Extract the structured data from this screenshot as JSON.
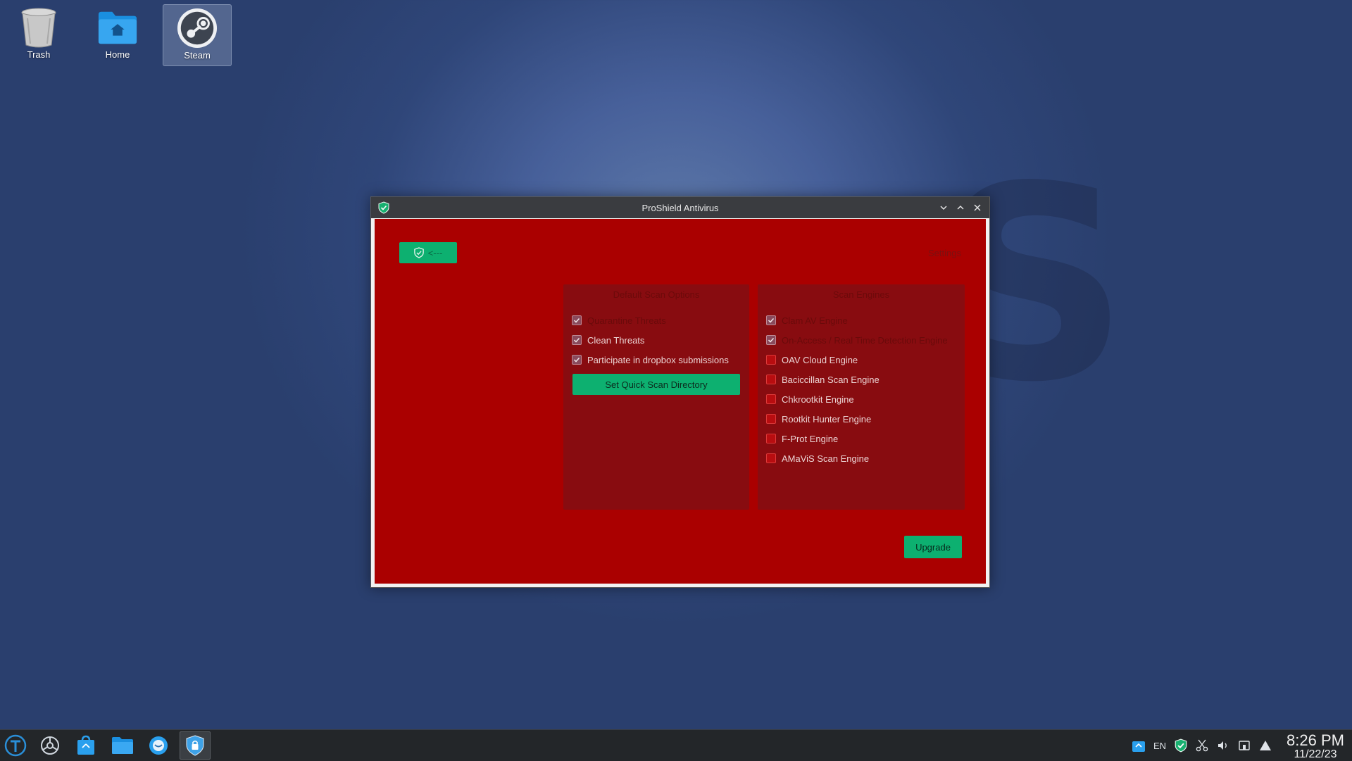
{
  "desktop": {
    "icons": [
      {
        "label": "Trash"
      },
      {
        "label": "Home"
      },
      {
        "label": "Steam"
      }
    ]
  },
  "window": {
    "title": "ProShield Antivirus",
    "back_button_label": "<---",
    "settings_label": "Settings",
    "default_scan_options": {
      "title": "Default Scan Options",
      "options": [
        {
          "label": "Quarantine Threats",
          "checked": true
        },
        {
          "label": "Clean Threats",
          "checked": true
        },
        {
          "label": "Participate in dropbox submissions",
          "checked": true
        }
      ],
      "set_dir_button": "Set Quick Scan Directory"
    },
    "scan_engines": {
      "title": "Scan Engines",
      "engines": [
        {
          "label": "Clam AV Engine",
          "checked": true
        },
        {
          "label": "On-Access / Real Time Detection Engine",
          "checked": true
        },
        {
          "label": "OAV Cloud Engine",
          "checked": false
        },
        {
          "label": "Baciccillan Scan Engine",
          "checked": false
        },
        {
          "label": "Chkrootkit Engine",
          "checked": false
        },
        {
          "label": "Rootkit Hunter Engine",
          "checked": false
        },
        {
          "label": "F-Prot Engine",
          "checked": false
        },
        {
          "label": "AMaViS Scan Engine",
          "checked": false
        }
      ]
    },
    "upgrade_button": "Upgrade"
  },
  "taskbar": {
    "tray": {
      "language": "EN"
    },
    "clock": {
      "time": "8:26 PM",
      "date": "11/22/23"
    }
  },
  "colors": {
    "content_bg": "#aa0000",
    "panel_bg": "#880c10",
    "accent_green": "#0db070",
    "taskbar_bg": "#232629"
  }
}
